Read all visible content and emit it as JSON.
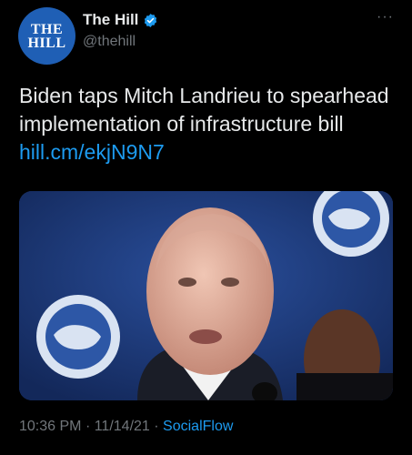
{
  "account": {
    "avatar_line1": "THE",
    "avatar_line2": "HILL",
    "display_name": "The Hill",
    "handle": "@thehill",
    "more_label": "···"
  },
  "tweet": {
    "text": "Biden taps Mitch Landrieu to spearhead implementation of infrastructure bill",
    "link": "hill.cm/ekjN9N7",
    "time": "10:36 PM",
    "separator1": "·",
    "date": "11/14/21",
    "separator2": "·",
    "source": "SocialFlow"
  },
  "colors": {
    "background": "#000000",
    "text": "#e7e9ea",
    "secondary": "#71767b",
    "link": "#1d9bf0",
    "avatar": "#1f5fb5",
    "verified": "#1d9bf0"
  },
  "icons": {
    "verified": "verified-badge-icon",
    "more": "more-horizontal-icon"
  }
}
